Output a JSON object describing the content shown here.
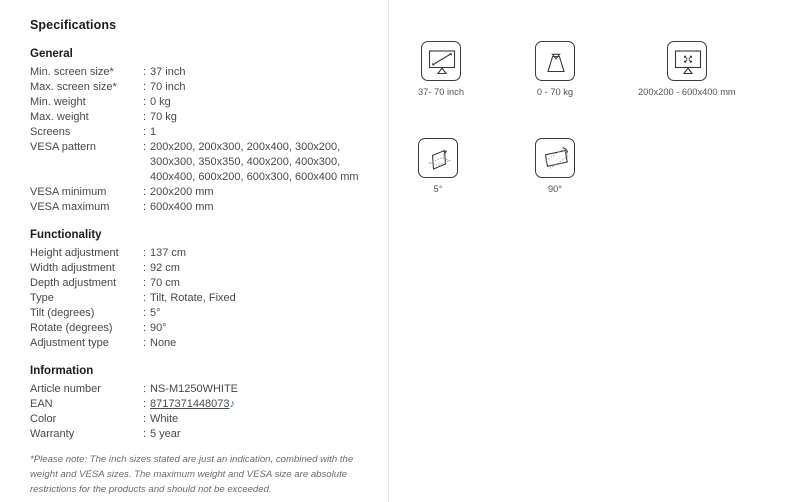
{
  "page_title": "Specifications",
  "groups": [
    {
      "title": "General",
      "rows": [
        {
          "label": "Min. screen size*",
          "sep": ":",
          "value": [
            "37 inch"
          ]
        },
        {
          "label": "Max. screen size*",
          "sep": ":",
          "value": [
            "70 inch"
          ]
        },
        {
          "label": "Min. weight",
          "sep": ":",
          "value": [
            "0 kg"
          ]
        },
        {
          "label": "Max. weight",
          "sep": ":",
          "value": [
            "70 kg"
          ]
        },
        {
          "label": "Screens",
          "sep": ":",
          "value": [
            "1"
          ]
        },
        {
          "label": "VESA pattern",
          "sep": ":",
          "value": [
            "200x200, 200x300, 200x400, 300x200,",
            "300x300, 350x350, 400x200, 400x300,",
            "400x400, 600x200, 600x300, 600x400 mm"
          ]
        },
        {
          "label": "VESA minimum",
          "sep": ":",
          "value": [
            "200x200 mm"
          ]
        },
        {
          "label": "VESA maximum",
          "sep": ":",
          "value": [
            "600x400 mm"
          ]
        }
      ]
    },
    {
      "title": "Functionality",
      "rows": [
        {
          "label": "Height adjustment",
          "sep": ":",
          "value": [
            "137 cm"
          ]
        },
        {
          "label": "Width adjustment",
          "sep": ":",
          "value": [
            "92 cm"
          ]
        },
        {
          "label": "Depth adjustment",
          "sep": ":",
          "value": [
            "70 cm"
          ]
        },
        {
          "label": "Type",
          "sep": ":",
          "value": [
            "Tilt, Rotate, Fixed"
          ]
        },
        {
          "label": "Tilt (degrees)",
          "sep": ":",
          "value": [
            "5°"
          ]
        },
        {
          "label": "Rotate (degrees)",
          "sep": ":",
          "value": [
            "90°"
          ]
        },
        {
          "label": "Adjustment type",
          "sep": ":",
          "value": [
            "None"
          ]
        }
      ]
    },
    {
      "title": "Information",
      "rows": [
        {
          "label": "Article number",
          "sep": ":",
          "value": [
            "NS-M1250WHITE"
          ]
        },
        {
          "label": "EAN",
          "sep": ":",
          "value": [
            "8717371448073"
          ],
          "link": true,
          "glyph": "♪"
        },
        {
          "label": "Color",
          "sep": ":",
          "value": [
            "White"
          ]
        },
        {
          "label": "Warranty",
          "sep": ":",
          "value": [
            "5 year"
          ]
        }
      ]
    }
  ],
  "footnote": "*Please note: The inch sizes stated are just an indication, combined with the weight and VESA sizes. The maximum weight and VESA size are absolute restrictions for the products and should not be exceeded.",
  "icons": [
    {
      "name": "screen-size-icon",
      "caption": "37- 70 inch"
    },
    {
      "name": "weight-icon",
      "caption": "0 - 70 kg"
    },
    {
      "name": "vesa-pattern-icon",
      "caption": "200x200 - 600x400 mm"
    },
    {
      "name": "tilt-icon",
      "caption": "5°"
    },
    {
      "name": "rotate-icon",
      "caption": "90°"
    }
  ],
  "colors": {
    "text": "#49494b",
    "heading": "#1c1c1c",
    "link_accent": "#2a6ebb",
    "icon_stroke": "#3a3a3a",
    "divider": "#e6e6e6"
  }
}
